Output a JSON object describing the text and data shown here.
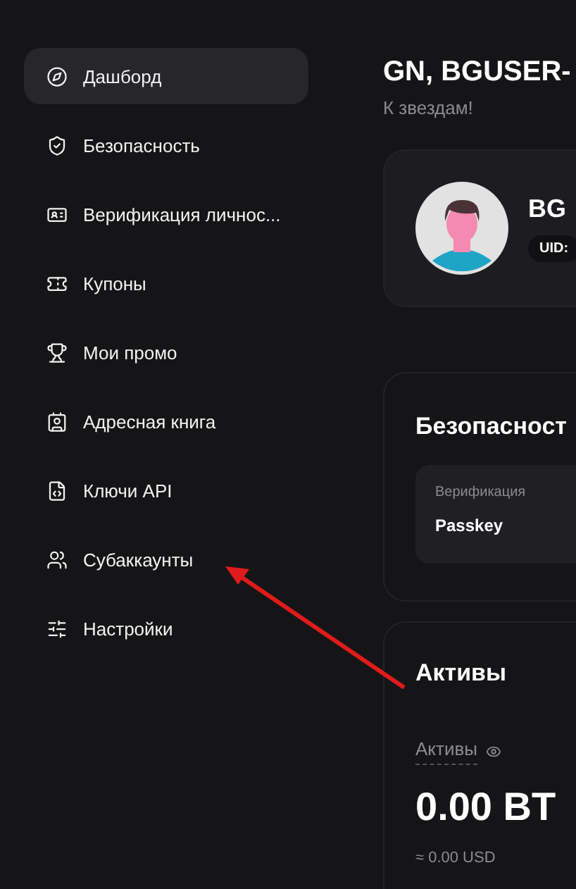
{
  "sidebar": {
    "items": [
      {
        "label": "Дашборд",
        "selected": true
      },
      {
        "label": "Безопасность",
        "selected": false
      },
      {
        "label": "Верификация личнос...",
        "selected": false
      },
      {
        "label": "Купоны",
        "selected": false
      },
      {
        "label": "Мои промо",
        "selected": false
      },
      {
        "label": "Адресная книга",
        "selected": false
      },
      {
        "label": "Ключи API",
        "selected": false
      },
      {
        "label": "Субаккаунты",
        "selected": false
      },
      {
        "label": "Настройки",
        "selected": false
      }
    ]
  },
  "header": {
    "title": "GN, BGUSER-",
    "subtitle": "К звездам!"
  },
  "profile": {
    "name": "BG",
    "uid": "UID:"
  },
  "security": {
    "title": "Безопасност",
    "label": "Верификация",
    "value": "Passkey"
  },
  "assets": {
    "title": "Активы",
    "label": "Активы",
    "amount": "0.00 BT",
    "usd": "≈ 0.00 USD"
  }
}
